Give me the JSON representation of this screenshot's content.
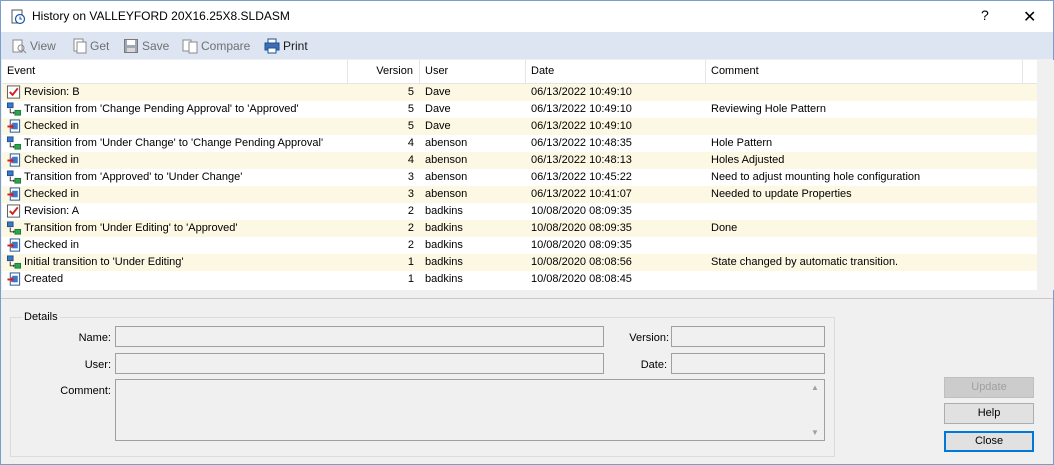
{
  "window": {
    "title": "History on VALLEYFORD 20X16.25X8.SLDASM",
    "help_glyph": "?",
    "close_glyph": "✕"
  },
  "toolbar": {
    "items": [
      {
        "label": "View",
        "icon": "view-icon"
      },
      {
        "label": "Get",
        "icon": "get-icon"
      },
      {
        "label": "Save",
        "icon": "save-icon"
      },
      {
        "label": "Compare",
        "icon": "compare-icon"
      },
      {
        "label": "Print",
        "icon": "print-icon"
      }
    ]
  },
  "list": {
    "columns": [
      "Event",
      "Version",
      "User",
      "Date",
      "Comment"
    ],
    "rows": [
      {
        "icon": "revision-icon",
        "event": "Revision: B",
        "version": "5",
        "user": "Dave",
        "date": "06/13/2022 10:49:10",
        "comment": ""
      },
      {
        "icon": "transition-icon",
        "event": "Transition from 'Change Pending Approval' to 'Approved'",
        "version": "5",
        "user": "Dave",
        "date": "06/13/2022 10:49:10",
        "comment": "Reviewing Hole Pattern"
      },
      {
        "icon": "checkin-icon",
        "event": "Checked in",
        "version": "5",
        "user": "Dave",
        "date": "06/13/2022 10:49:10",
        "comment": ""
      },
      {
        "icon": "transition-icon",
        "event": "Transition from 'Under Change' to 'Change Pending Approval'",
        "version": "4",
        "user": "abenson",
        "date": "06/13/2022 10:48:35",
        "comment": "Hole Pattern"
      },
      {
        "icon": "checkin-icon",
        "event": "Checked in",
        "version": "4",
        "user": "abenson",
        "date": "06/13/2022 10:48:13",
        "comment": "Holes Adjusted"
      },
      {
        "icon": "transition-icon",
        "event": "Transition from 'Approved' to 'Under Change'",
        "version": "3",
        "user": "abenson",
        "date": "06/13/2022 10:45:22",
        "comment": "Need to adjust mounting hole configuration"
      },
      {
        "icon": "checkin-icon",
        "event": "Checked in",
        "version": "3",
        "user": "abenson",
        "date": "06/13/2022 10:41:07",
        "comment": "Needed to update Properties"
      },
      {
        "icon": "revision-icon",
        "event": "Revision: A",
        "version": "2",
        "user": "badkins",
        "date": "10/08/2020 08:09:35",
        "comment": ""
      },
      {
        "icon": "transition-icon",
        "event": "Transition from 'Under Editing' to 'Approved'",
        "version": "2",
        "user": "badkins",
        "date": "10/08/2020 08:09:35",
        "comment": "Done"
      },
      {
        "icon": "checkin-icon",
        "event": "Checked in",
        "version": "2",
        "user": "badkins",
        "date": "10/08/2020 08:09:35",
        "comment": ""
      },
      {
        "icon": "transition-icon",
        "event": "Initial transition to 'Under Editing'",
        "version": "1",
        "user": "badkins",
        "date": "10/08/2020 08:08:56",
        "comment": "State changed by automatic transition."
      },
      {
        "icon": "checkin-icon",
        "event": "Created",
        "version": "1",
        "user": "badkins",
        "date": "10/08/2020 08:08:45",
        "comment": ""
      }
    ]
  },
  "details": {
    "legend": "Details",
    "name_label": "Name:",
    "name_value": "",
    "version_label": "Version:",
    "version_value": "",
    "user_label": "User:",
    "user_value": "",
    "date_label": "Date:",
    "date_value": "",
    "comment_label": "Comment:",
    "comment_value": ""
  },
  "buttons": {
    "update": "Update",
    "help": "Help",
    "close": "Close"
  }
}
